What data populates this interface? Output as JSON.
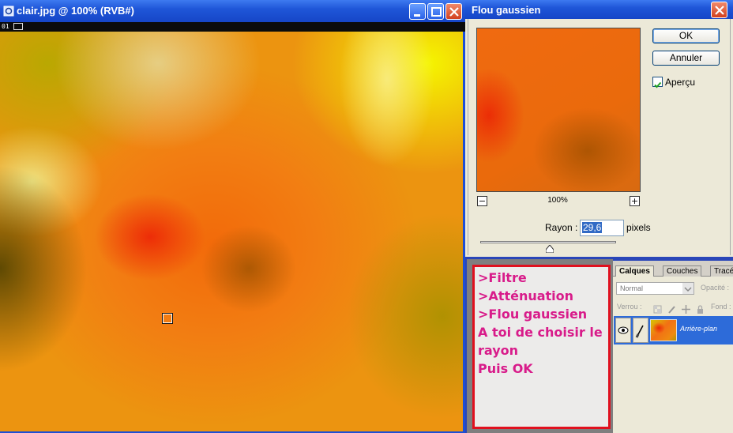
{
  "document_window": {
    "title": "clair.jpg @ 100% (RVB#)",
    "ruler_label": "01",
    "buttons": [
      "minimize",
      "maximize",
      "close"
    ]
  },
  "blur_dialog": {
    "title": "Flou gaussien",
    "ok_label": "OK",
    "cancel_label": "Annuler",
    "preview_checkbox": {
      "label": "Aperçu",
      "checked": true
    },
    "zoom_level": "100%",
    "zoom_out_symbol": "−",
    "zoom_in_symbol": "+",
    "radius_label": "Rayon :",
    "radius_value": "29,6",
    "radius_unit": "pixels"
  },
  "layers_panel": {
    "tabs": [
      "Calques",
      "Couches",
      "Tracé"
    ],
    "blend_mode": "Normal",
    "opacity_label": "Opacité :",
    "lock_label": "Verrou :",
    "fill_label": "Fond :",
    "layer_name": "Arrière-plan"
  },
  "instructions": {
    "lines": [
      ">Filtre",
      ">Atténuation",
      ">Flou gaussien",
      "A toi de choisir le",
      "rayon",
      "Puis OK"
    ]
  },
  "colors": {
    "titlebar": "#1f56d8",
    "note_border": "#e0101e",
    "note_text": "#d81b8a"
  }
}
